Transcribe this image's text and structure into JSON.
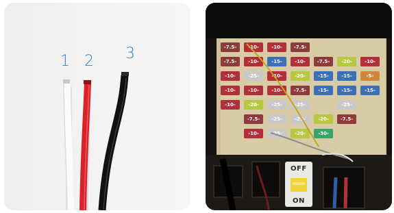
{
  "left_panel": {
    "wire_labels": [
      "1",
      "2",
      "3"
    ],
    "label_color": "#2f7fc1",
    "wire_colors": [
      "#ffffff",
      "#d9222a",
      "#111111"
    ]
  },
  "right_panel": {
    "fuse_rows": [
      [
        "-7.5-",
        "-10-",
        "-10-",
        "-7.5-",
        "",
        "",
        ""
      ],
      [
        "-7.5-",
        "-10-",
        "-15-",
        "-10-",
        "-7.5-",
        "-20-",
        "-10-"
      ],
      [
        "-10-",
        "-25-",
        "-10-",
        "-20-",
        "-15-",
        "-15-",
        "-5-"
      ],
      [
        "-10-",
        "-10-",
        "-10-",
        "-7.5-",
        "-15-",
        "-15-",
        "-15-"
      ],
      [
        "-10-",
        "-20-",
        "-25-",
        "-25-",
        "",
        "-25-",
        ""
      ],
      [
        "",
        "-7.5-",
        "-25-",
        "-25-",
        "-20-",
        "-7.5-",
        ""
      ],
      [
        "",
        "-10-",
        "-25-",
        "-20-",
        "-30-",
        "",
        ""
      ]
    ],
    "switch": {
      "top_label": "OFF",
      "bottom_label": "ON"
    }
  }
}
